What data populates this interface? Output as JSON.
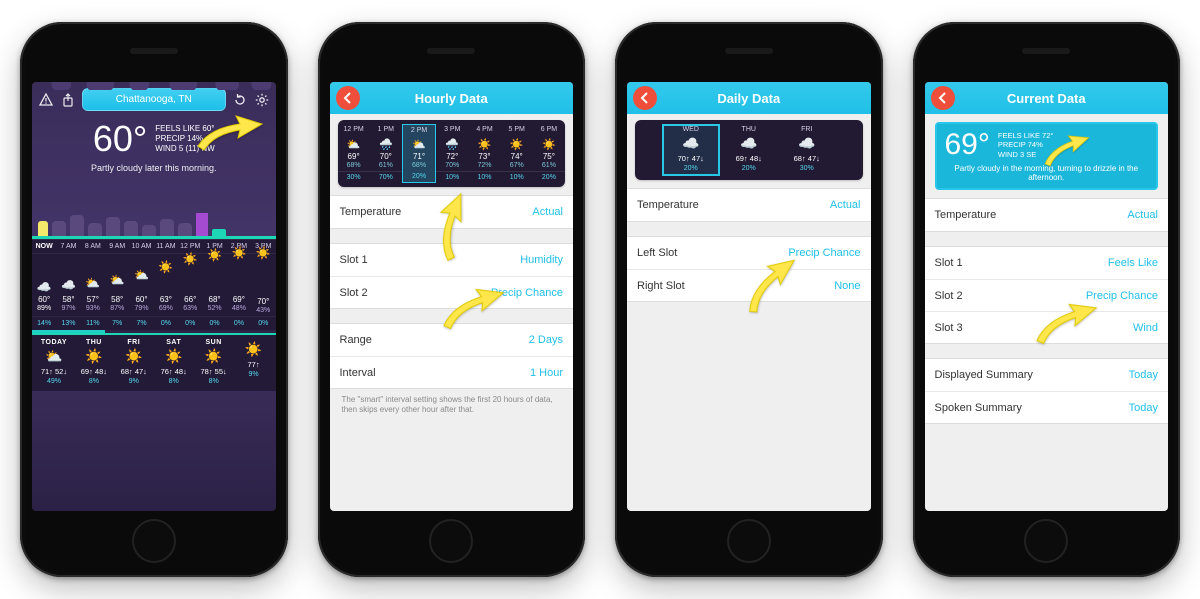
{
  "colors": {
    "accent": "#20bfe7",
    "arrow": "#ffe64a"
  },
  "phoneA": {
    "location": "Chattanooga, TN",
    "hero": {
      "temp": "60°",
      "feels": "FEELS LIKE 60°",
      "precip": "PRECIP 14%",
      "wind": "WIND 5 (11) NW",
      "summary": "Partly cloudy later this morning."
    },
    "hourlyHead": [
      "NOW",
      "7 AM",
      "8 AM",
      "9 AM",
      "10 AM",
      "11 AM",
      "12 PM",
      "1 PM",
      "2 PM",
      "3 PM"
    ],
    "hourly": [
      {
        "t": "60°",
        "h": "89%",
        "ic": "☁️"
      },
      {
        "t": "58°",
        "h": "97%",
        "ic": "☁️"
      },
      {
        "t": "57°",
        "h": "93%",
        "ic": "⛅"
      },
      {
        "t": "58°",
        "h": "87%",
        "ic": "⛅"
      },
      {
        "t": "60°",
        "h": "79%",
        "ic": "⛅"
      },
      {
        "t": "63°",
        "h": "69%",
        "ic": "☀️"
      },
      {
        "t": "66°",
        "h": "63%",
        "ic": "☀️"
      },
      {
        "t": "68°",
        "h": "52%",
        "ic": "☀️"
      },
      {
        "t": "69°",
        "h": "48%",
        "ic": "☀️"
      },
      {
        "t": "70°",
        "h": "43%",
        "ic": "☀️"
      }
    ],
    "precipRow": [
      "14%",
      "13%",
      "11%",
      "7%",
      "7%",
      "0%",
      "0%",
      "0%",
      "0%",
      "0%"
    ],
    "daily": [
      {
        "lbl": "TODAY",
        "ic": "⛅",
        "hi": "71↑",
        "lo": "52↓",
        "pc": "49%"
      },
      {
        "lbl": "THU",
        "ic": "☀️",
        "hi": "69↑",
        "lo": "48↓",
        "pc": "8%"
      },
      {
        "lbl": "FRI",
        "ic": "☀️",
        "hi": "68↑",
        "lo": "47↓",
        "pc": "9%"
      },
      {
        "lbl": "SAT",
        "ic": "☀️",
        "hi": "76↑",
        "lo": "48↓",
        "pc": "8%"
      },
      {
        "lbl": "SUN",
        "ic": "☀️",
        "hi": "78↑",
        "lo": "55↓",
        "pc": "8%"
      },
      {
        "lbl": "",
        "ic": "☀️",
        "hi": "77↑",
        "lo": "",
        "pc": "9%"
      }
    ]
  },
  "phoneB": {
    "title": "Hourly Data",
    "previewHours": [
      "12 PM",
      "1 PM",
      "2 PM",
      "3 PM",
      "4 PM",
      "5 PM",
      "6 PM"
    ],
    "previewCols": [
      {
        "ic": "⛅",
        "a": "69°",
        "b": "68%",
        "c": "30%"
      },
      {
        "ic": "🌧️",
        "a": "70°",
        "b": "61%",
        "c": "70%"
      },
      {
        "ic": "⛅",
        "a": "71°",
        "b": "68%",
        "c": "20%",
        "hi": true
      },
      {
        "ic": "🌧️",
        "a": "72°",
        "b": "70%",
        "c": "10%"
      },
      {
        "ic": "☀️",
        "a": "73°",
        "b": "72%",
        "c": "10%"
      },
      {
        "ic": "☀️",
        "a": "74°",
        "b": "67%",
        "c": "10%"
      },
      {
        "ic": "☀️",
        "a": "75°",
        "b": "61%",
        "c": "20%"
      }
    ],
    "rows": [
      {
        "label": "Temperature",
        "value": "Actual"
      },
      {
        "label": "Slot 1",
        "value": "Humidity",
        "newgroup": true
      },
      {
        "label": "Slot 2",
        "value": "Precip Chance"
      },
      {
        "label": "Range",
        "value": "2 Days",
        "newgroup": true
      },
      {
        "label": "Interval",
        "value": "1 Hour"
      }
    ],
    "note": "The \"smart\" interval setting shows the first 20 hours of data, then skips every other hour after that."
  },
  "phoneC": {
    "title": "Daily Data",
    "previewDays": [
      {
        "lbl": "WED",
        "ic": "☁️",
        "hi": "70↑",
        "lo": "47↓",
        "pc": "20%",
        "hiCol": true
      },
      {
        "lbl": "THU",
        "ic": "☁️",
        "hi": "69↑",
        "lo": "48↓",
        "pc": "20%"
      },
      {
        "lbl": "FRI",
        "ic": "☁️",
        "hi": "68↑",
        "lo": "47↓",
        "pc": "30%"
      }
    ],
    "rows": [
      {
        "label": "Temperature",
        "value": "Actual"
      },
      {
        "label": "Left Slot",
        "value": "Precip Chance",
        "newgroup": true
      },
      {
        "label": "Right Slot",
        "value": "None"
      }
    ]
  },
  "phoneD": {
    "title": "Current Data",
    "card": {
      "temp": "69°",
      "feels": "FEELS LIKE 72°",
      "precip": "PRECIP 74%",
      "wind": "WIND 3 SE",
      "summary": "Partly cloudy in the morning, turning to drizzle in the afternoon."
    },
    "rows": [
      {
        "label": "Temperature",
        "value": "Actual"
      },
      {
        "label": "Slot 1",
        "value": "Feels Like",
        "newgroup": true
      },
      {
        "label": "Slot 2",
        "value": "Precip Chance"
      },
      {
        "label": "Slot 3",
        "value": "Wind"
      },
      {
        "label": "Displayed Summary",
        "value": "Today",
        "newgroup": true
      },
      {
        "label": "Spoken Summary",
        "value": "Today"
      }
    ]
  }
}
